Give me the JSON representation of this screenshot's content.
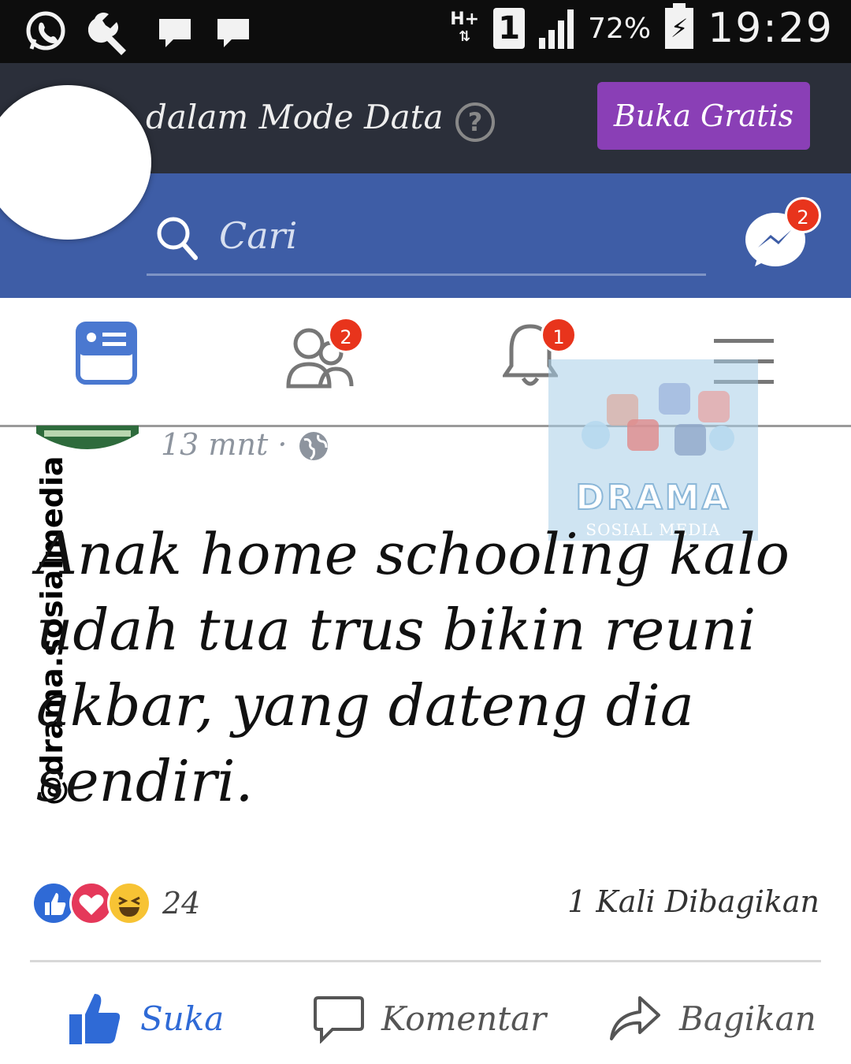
{
  "status_bar": {
    "network": "H+",
    "sim_slot": "1",
    "battery_percent": "72%",
    "time": "19:29",
    "left_icons": [
      "whatsapp-icon",
      "wrench-icon",
      "message-icon",
      "message-icon"
    ]
  },
  "data_banner": {
    "text": "dalam Mode Data",
    "help": "?",
    "open_free_button": "Buka Gratis"
  },
  "header": {
    "search_placeholder": "Cari",
    "messenger_badge": "2"
  },
  "tabs": [
    {
      "name": "news-feed",
      "badge": ""
    },
    {
      "name": "friend-requests",
      "badge": "2"
    },
    {
      "name": "notifications",
      "badge": "1"
    },
    {
      "name": "menu",
      "badge": ""
    }
  ],
  "watermark": {
    "brand": "DRAMA",
    "subtitle": "SOSIAL MEDIA"
  },
  "side_handle": "@drama.sosialmedia",
  "post": {
    "time": "13 mnt",
    "privacy": "·",
    "text": "Anak home schooling kalo udah tua trus bikin reuni akbar, yang dateng dia sendiri.",
    "reaction_count": "24",
    "shares": "1 Kali Dibagikan"
  },
  "actions": {
    "like": "Suka",
    "comment": "Komentar",
    "share": "Bagikan"
  },
  "colors": {
    "fb_blue": "#3e5da6",
    "banner_dark": "#2b2f3a",
    "button_purple": "#8a3fb6",
    "badge_red": "#e8341c",
    "like_blue": "#2f6ad6"
  }
}
